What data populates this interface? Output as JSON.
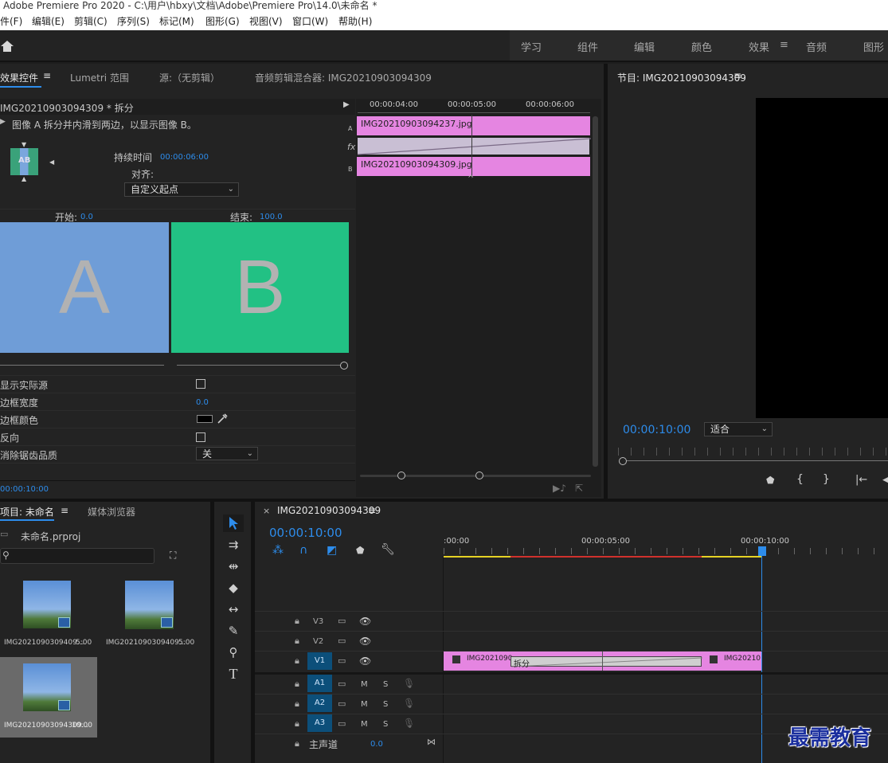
{
  "titlebar": {
    "text": "Adobe Premiere Pro 2020 - C:\\用户\\hbxy\\文档\\Adobe\\Premiere Pro\\14.0\\未命名 *"
  },
  "menu": {
    "items": [
      "件(F)",
      "编辑(E)",
      "剪辑(C)",
      "序列(S)",
      "标记(M)",
      "图形(G)",
      "视图(V)",
      "窗口(W)",
      "帮助(H)"
    ]
  },
  "workspaces": {
    "items": [
      "学习",
      "组件",
      "编辑",
      "颜色",
      "效果",
      "音频",
      "图形"
    ],
    "active": "效果"
  },
  "effect_controls": {
    "tabs": [
      "效果控件",
      "Lumetri 范围",
      "源:（无剪辑）",
      "音频剪辑混合器: IMG20210903094309"
    ],
    "clip_name": "IMG20210903094309 * 拆分",
    "description": "图像 A 拆分并内滑到两边，以显示图像 B。",
    "duration_label": "持续时间",
    "duration_value": "00:00:06:00",
    "align_label": "对齐:",
    "align_value": "自定义起点",
    "start_label": "开始:",
    "start_value": "0.0",
    "end_label": "结束:",
    "end_value": "100.0",
    "preview_a": "A",
    "preview_b": "B",
    "icon_letters": "AB",
    "props": [
      {
        "label": "显示实际源",
        "type": "checkbox"
      },
      {
        "label": "边框宽度",
        "value": "0.0"
      },
      {
        "label": "边框颜色",
        "type": "color",
        "color": "#000000"
      },
      {
        "label": "反向",
        "type": "checkbox"
      },
      {
        "label": "消除锯齿品质",
        "value": "关"
      }
    ],
    "footer_time": "00:00:10:00",
    "mini_timeline": {
      "ticks": [
        "00:00:04:00",
        "00:00:05:00",
        "00:00:06:00"
      ],
      "track_a_label": "A",
      "track_b_label": "B",
      "fx_label": "fx",
      "clip_a": "IMG20210903094237.jpg",
      "clip_b": "IMG20210903094309.jpg"
    }
  },
  "program": {
    "title": "节目: IMG20210903094309",
    "timecode": "00:00:10:00",
    "fit": "适合"
  },
  "project": {
    "tabs": [
      "项目: 未命名",
      "媒体浏览器"
    ],
    "file": "未命名.prproj",
    "items": [
      {
        "name": "IMG2021090309409...",
        "duration": "5:00"
      },
      {
        "name": "IMG2021090309409...",
        "duration": "5:00"
      },
      {
        "name": "IMG20210903094309...",
        "duration": "10:00"
      }
    ]
  },
  "timeline": {
    "tab": "IMG20210903094309",
    "timecode": "00:00:10:00",
    "ruler": [
      ":00:00",
      "00:00:05:00",
      "00:00:10:00"
    ],
    "tracks_video": [
      "V3",
      "V2",
      "V1"
    ],
    "tracks_audio": [
      "A1",
      "A2",
      "A3"
    ],
    "master_label": "主声道",
    "master_value": "0.0",
    "m_label": "M",
    "s_label": "S",
    "clip_left": "IMG2021090",
    "clip_right": "IMG20210",
    "transition": "拆分"
  },
  "watermark": "最需教育"
}
